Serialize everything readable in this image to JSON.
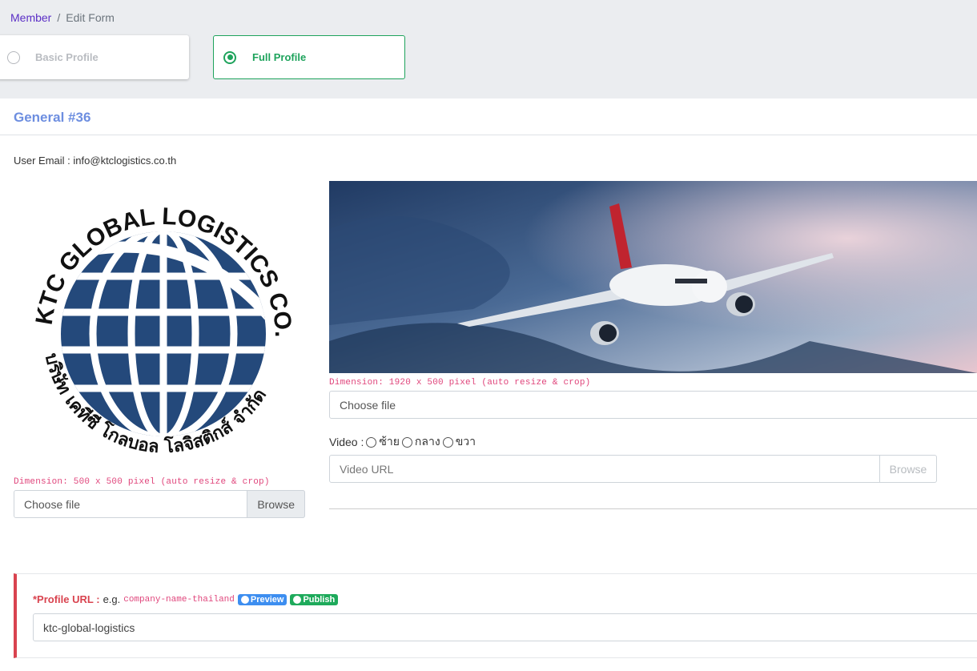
{
  "breadcrumb": {
    "parent": "Member",
    "current": "Edit Form",
    "separator": "/"
  },
  "steps": [
    {
      "label": "Basic Profile",
      "selected": false
    },
    {
      "label": "Full Profile",
      "selected": true
    }
  ],
  "panel": {
    "title": "General #36"
  },
  "user_email": {
    "label": "User Email : ",
    "value": "info@ktclogistics.co.th"
  },
  "logo": {
    "text_top": "KTC GLOBAL LOGISTICS CO.,LTD",
    "text_bottom": "บริษัท เคทีซี โกลบอล โลจิสติกส์ จำกัด",
    "dimension_note": "Dimension: 500 x 500 pixel (auto resize & crop)",
    "file_placeholder": "Choose file",
    "browse_label": "Browse"
  },
  "cover": {
    "dimension_note": "Dimension: 1920 x 500 pixel (auto resize & crop)",
    "file_placeholder": "Choose file"
  },
  "video": {
    "label": "Video :",
    "options": [
      "ซ้าย",
      "กลาง",
      "ขวา"
    ],
    "url_placeholder": "Video URL",
    "browse_label": "Browse"
  },
  "profile_url": {
    "label": "*Profile URL :",
    "eg": "e.g.",
    "example": "company-name-thailand",
    "preview_label": "Preview",
    "publish_label": "Publish",
    "value": "ktc-global-logistics"
  },
  "colors": {
    "accent_green": "#1ea35c",
    "title_blue": "#6d8ee0",
    "danger_red": "#d9434f",
    "code_pink": "#e0467c",
    "preview_blue": "#3d8ef0"
  }
}
